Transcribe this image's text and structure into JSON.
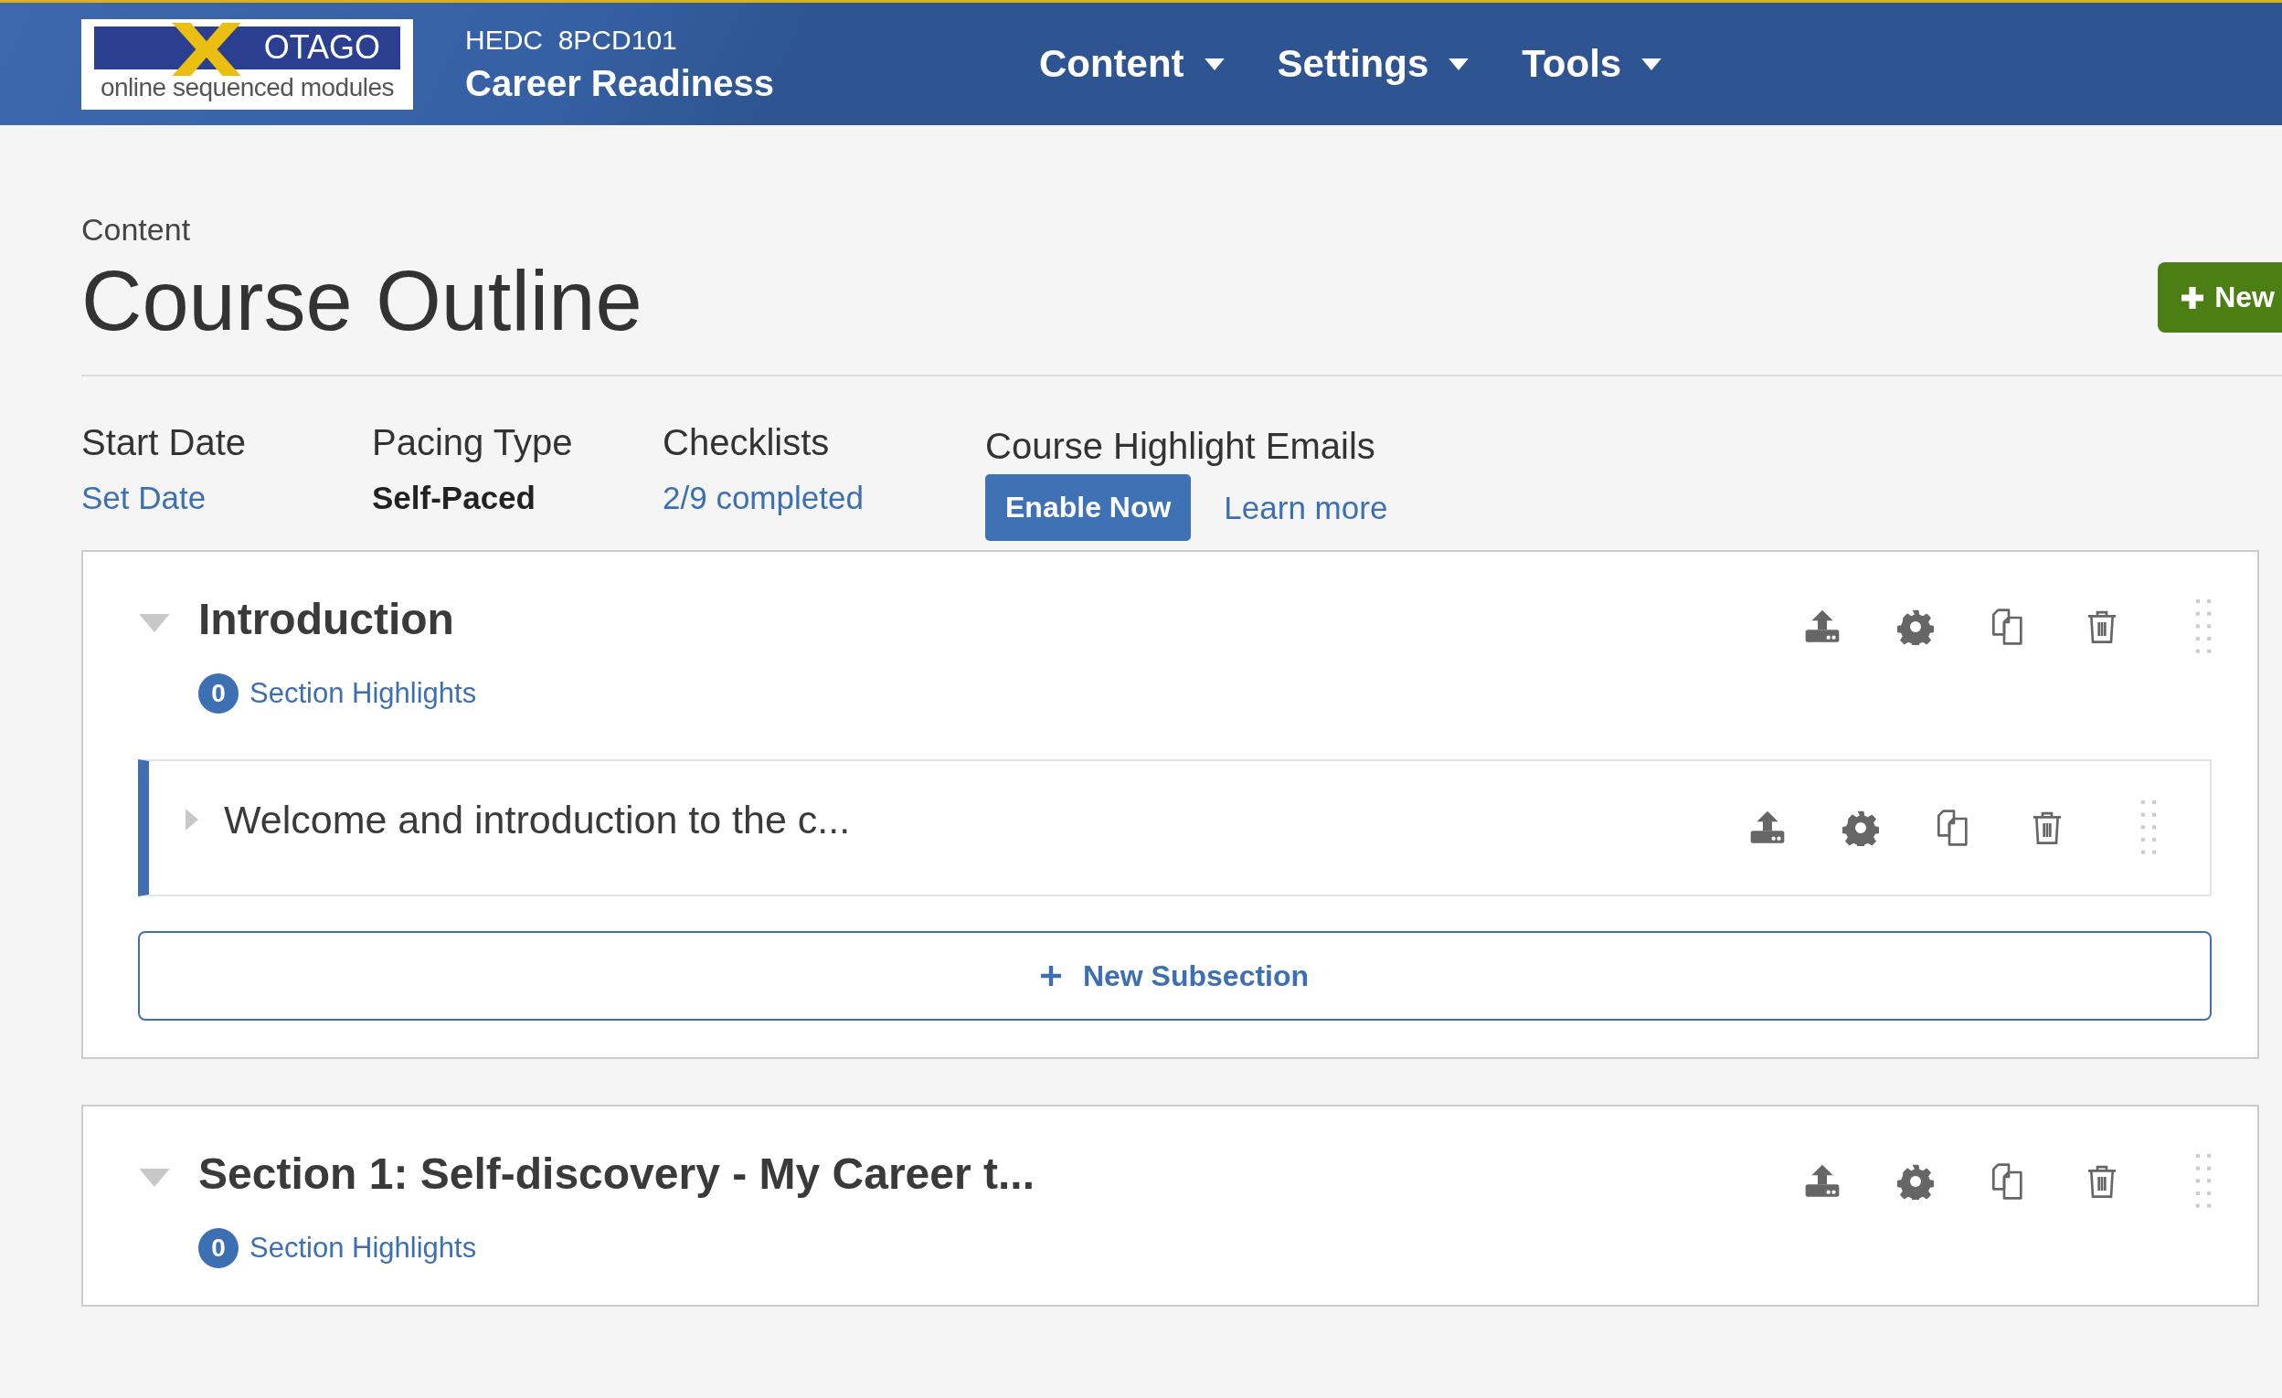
{
  "header": {
    "logo": {
      "word": "OTAGO",
      "tagline": "online sequenced modules"
    },
    "course_code": "HEDC  8PCD101",
    "course_name": "Career Readiness",
    "nav": [
      {
        "label": "Content"
      },
      {
        "label": "Settings"
      },
      {
        "label": "Tools"
      }
    ]
  },
  "page": {
    "breadcrumb": "Content",
    "title": "Course Outline",
    "new_button": "New"
  },
  "stats": [
    {
      "kind": "link",
      "label": "Start Date",
      "value": "Set Date"
    },
    {
      "kind": "text",
      "label": "Pacing Type",
      "value": "Self-Paced"
    },
    {
      "kind": "link",
      "label": "Checklists",
      "value": "2/9 completed"
    },
    {
      "kind": "actions",
      "label": "Course Highlight Emails",
      "button": "Enable Now",
      "link": "Learn more"
    }
  ],
  "sections": [
    {
      "title": "Introduction",
      "expanded": true,
      "highlights_count": "0",
      "highlights_label": "Section Highlights",
      "subsections": [
        {
          "title": "Welcome and introduction to the c...",
          "expanded": false
        }
      ],
      "new_subsection": "New Subsection"
    },
    {
      "title": "Section 1: Self-discovery - My Career t...",
      "expanded": true,
      "highlights_count": "0",
      "highlights_label": "Section Highlights"
    }
  ]
}
